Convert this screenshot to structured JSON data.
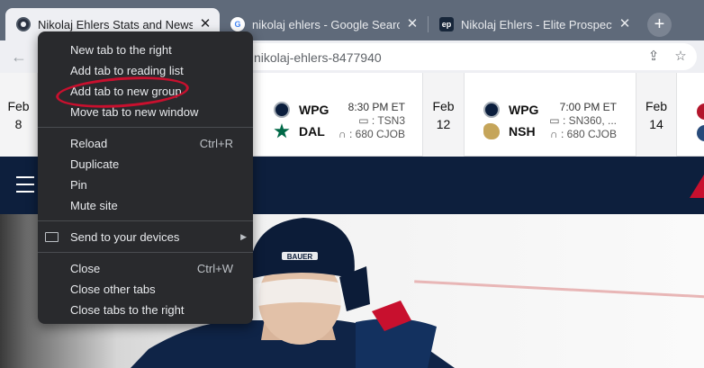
{
  "tabs": [
    {
      "title": "Nikolaj Ehlers Stats and News | NHL.com",
      "favicon": "nhl-icon",
      "active": true
    },
    {
      "title": "nikolaj ehlers - Google Search",
      "favicon": "google-icon",
      "active": false
    },
    {
      "title": "Nikolaj Ehlers - Elite Prospects",
      "favicon": "elite-prospects-icon",
      "active": false
    }
  ],
  "new_tab_label": "+",
  "address_bar": {
    "url_fragment": "nikolaj-ehlers-8477940"
  },
  "schedule": {
    "dates": [
      {
        "month": "Feb",
        "day": "8"
      },
      {
        "month": "Feb",
        "day": "12"
      },
      {
        "month": "Feb",
        "day": "14"
      }
    ],
    "games": [
      {
        "away": "WPG",
        "home": "DAL",
        "time": "8:30 PM ET",
        "tv": "TSN3",
        "radio": "680 CJOB"
      },
      {
        "away": "WPG",
        "home": "NSH",
        "time": "7:00 PM ET",
        "tv": "SN360, ...",
        "radio": "680 CJOB"
      }
    ]
  },
  "context_menu": {
    "group1": [
      "New tab to the right",
      "Add tab to reading list",
      "Add tab to new group",
      "Move tab to new window"
    ],
    "group2": [
      {
        "label": "Reload",
        "shortcut": "Ctrl+R"
      },
      {
        "label": "Duplicate",
        "shortcut": ""
      },
      {
        "label": "Pin",
        "shortcut": ""
      },
      {
        "label": "Mute site",
        "shortcut": ""
      }
    ],
    "send_to_devices": "Send to your devices",
    "group4": [
      {
        "label": "Close",
        "shortcut": "Ctrl+W"
      },
      {
        "label": "Close other tabs",
        "shortcut": ""
      },
      {
        "label": "Close tabs to the right",
        "shortcut": ""
      }
    ]
  },
  "annotation_color": "#c8102e",
  "colors": {
    "tabstrip": "#5f6a7a",
    "menu_bg": "#292a2d",
    "nav_bg": "#0d1f3d"
  }
}
